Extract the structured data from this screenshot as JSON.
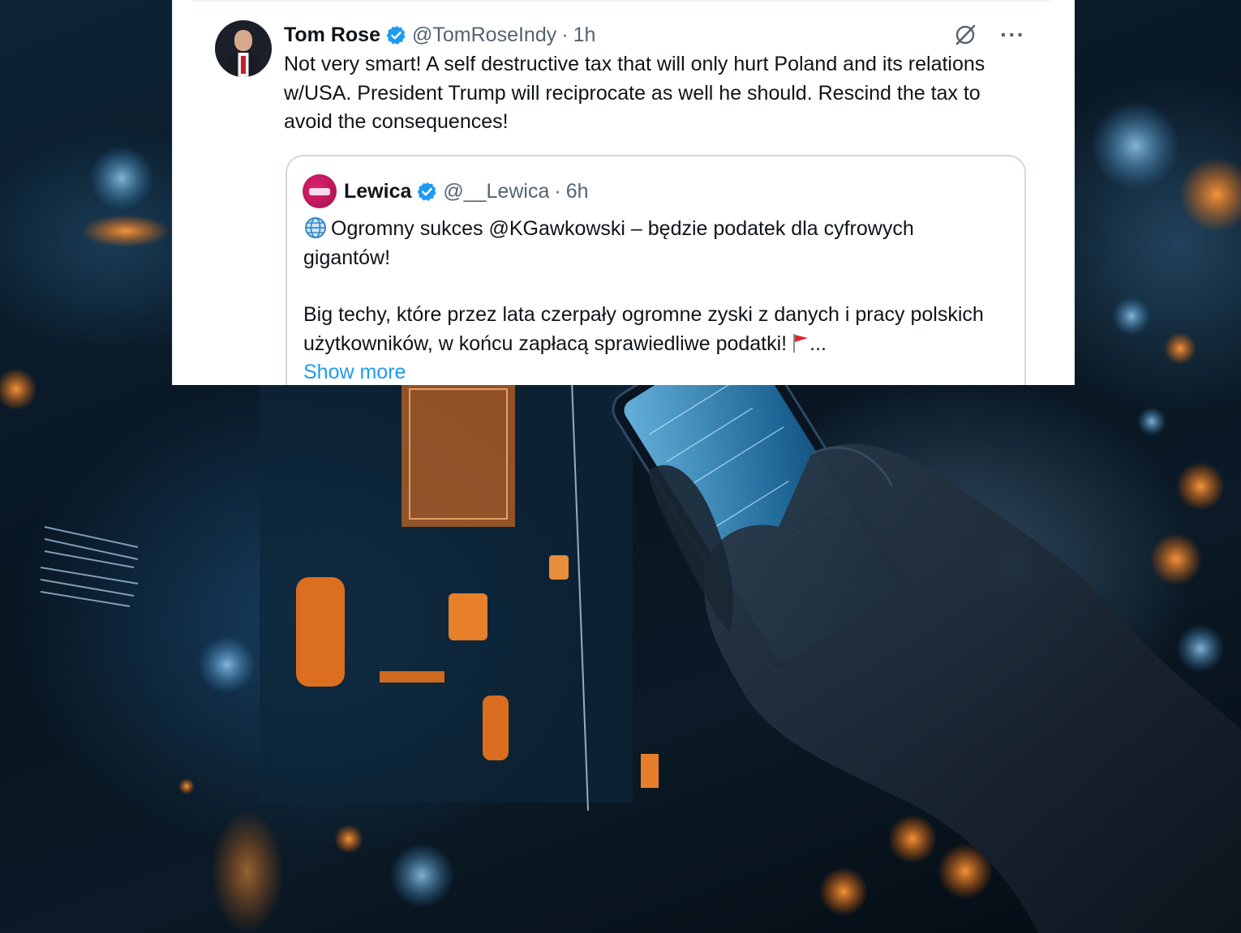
{
  "tweet": {
    "author_name": "Tom Rose",
    "author_handle": "@TomRoseIndy",
    "separator": "·",
    "time": "1h",
    "more_label": "···",
    "text": "Not very smart!  A self destructive tax that will only hurt Poland and its relations w/USA. President Trump will reciprocate as well he should. Rescind the tax to avoid the consequences!"
  },
  "quoted": {
    "author_name": "Lewica",
    "author_handle": "@__Lewica",
    "separator": "·",
    "time": "6h",
    "line1": "Ogromny sukces @KGawkowski – będzie podatek dla cyfrowych gigantów!",
    "line2": "Big techy, które przez lata czerpały ogromne zyski z danych i pracy polskich użytkowników, w końcu zapłacą sprawiedliwe podatki!",
    "ellipsis": "...",
    "show_more": "Show more"
  },
  "icons": {
    "verified": "verified-badge-icon",
    "grok": "grok-icon",
    "more": "more-icon",
    "globe": "globe-icon",
    "flag": "red-flag-icon"
  },
  "colors": {
    "verified_blue": "#1d9bf0",
    "link_blue": "#1d9bf0",
    "text": "#0f1419",
    "secondary": "#536471",
    "lewica_brand": "#c8175d"
  }
}
